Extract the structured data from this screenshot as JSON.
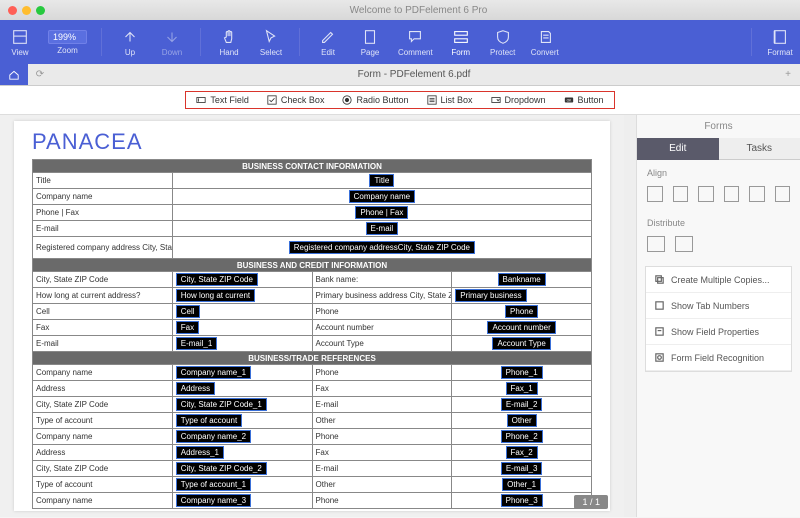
{
  "app_title": "Welcome to PDFelement 6 Pro",
  "toolbar": {
    "view": "View",
    "zoom": "Zoom",
    "zoom_val": "199%",
    "up": "Up",
    "down": "Down",
    "hand": "Hand",
    "select": "Select",
    "edit": "Edit",
    "page": "Page",
    "comment": "Comment",
    "form": "Form",
    "protect": "Protect",
    "convert": "Convert",
    "format": "Format"
  },
  "tab": {
    "filename": "Form - PDFelement 6.pdf"
  },
  "formbar": {
    "text_field": "Text Field",
    "check_box": "Check Box",
    "radio": "Radio Button",
    "list_box": "List Box",
    "dropdown": "Dropdown",
    "button": "Button"
  },
  "doc": {
    "brand": "PANACEA",
    "sec1": "BUSINESS CONTACT INFORMATION",
    "sec2": "BUSINESS AND CREDIT INFORMATION",
    "sec3": "BUSINESS/TRADE REFERENCES",
    "r1l": "Title",
    "r1f": "Title",
    "r2l": "Company name",
    "r2f": "Company name",
    "r3l": "Phone | Fax",
    "r3f": "Phone | Fax",
    "r4l": "E-mail",
    "r4f": "E-mail",
    "r5l": "Registered company address City, State ZIP Code",
    "r5f": "Registered company addressCity, State ZIP Code",
    "b1l": "City, State ZIP Code",
    "b1f": "City, State ZIP Code",
    "b1r": "Bank name:",
    "b1rf": "Bankname",
    "b2l": "How long at current address?",
    "b2f": "How long at current",
    "b2r": "Primary business address City, State ZIP Code",
    "b2rf": "Primary business",
    "b3l": "Cell",
    "b3f": "Cell",
    "b3r": "Phone",
    "b3rf": "Phone",
    "b4l": "Fax",
    "b4f": "Fax",
    "b4r": "Account number",
    "b4rf": "Account number",
    "b5l": "E-mail",
    "b5f": "E-mail_1",
    "b5r": "Account Type",
    "b5rf": "Account Type",
    "t1l": "Company name",
    "t1f": "Company name_1",
    "t1r": "Phone",
    "t1rf": "Phone_1",
    "t2l": "Address",
    "t2f": "Address",
    "t2r": "Fax",
    "t2rf": "Fax_1",
    "t3l": "City, State ZIP Code",
    "t3f": "City, State ZIP Code_1",
    "t3r": "E-mail",
    "t3rf": "E-mail_2",
    "t4l": "Type of account",
    "t4f": "Type of account",
    "t4r": "Other",
    "t4rf": "Other",
    "t5l": "Company name",
    "t5f": "Company name_2",
    "t5r": "Phone",
    "t5rf": "Phone_2",
    "t6l": "Address",
    "t6f": "Address_1",
    "t6r": "Fax",
    "t6rf": "Fax_2",
    "t7l": "City, State ZIP Code",
    "t7f": "City, State ZIP Code_2",
    "t7r": "E-mail",
    "t7rf": "E-mail_3",
    "t8l": "Type of account",
    "t8f": "Type of account_1",
    "t8r": "Other",
    "t8rf": "Other_1",
    "t9l": "Company name",
    "t9f": "Company name_3",
    "t9r": "Phone",
    "t9rf": "Phone_3"
  },
  "pagenum": "1 / 1",
  "panel": {
    "title": "Forms",
    "tab_edit": "Edit",
    "tab_tasks": "Tasks",
    "align": "Align",
    "distribute": "Distribute",
    "item1": "Create Multiple Copies...",
    "item2": "Show Tab Numbers",
    "item3": "Show Field Properties",
    "item4": "Form Field Recognition"
  }
}
